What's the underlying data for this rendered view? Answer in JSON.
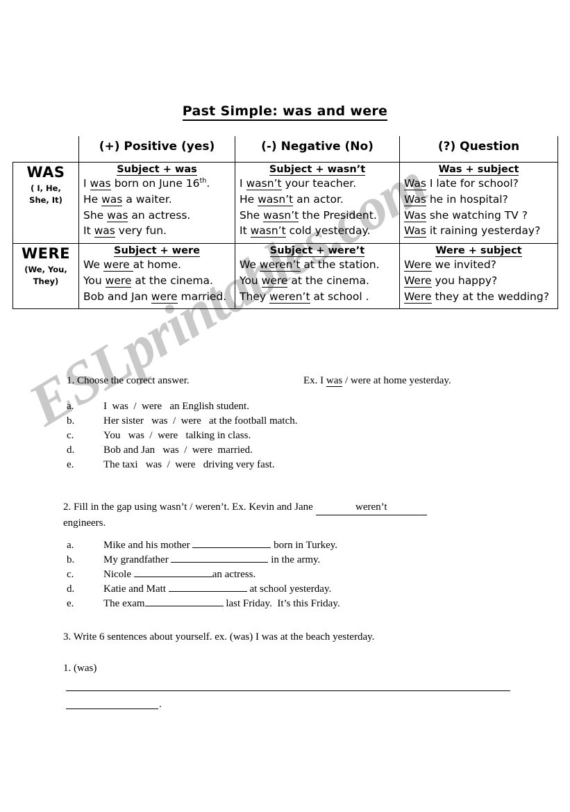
{
  "watermark": {
    "text": "ESLprintables.com"
  },
  "document": {
    "title": "Past Simple: was and were"
  },
  "table": {
    "headers": {
      "label": "",
      "positive": "(+) Positive (yes)",
      "negative": "(-) Negative (No)",
      "question": "(?) Question"
    },
    "rows": [
      {
        "label_main": "WAS",
        "label_sub": "( I, He,\nShe, It)",
        "positive": {
          "formula": "Subject  + was",
          "examples": [
            {
              "pre": "I ",
              "verb": "was",
              "post": " born on June 16",
              "sup": "th",
              "tail": "."
            },
            {
              "pre": "He ",
              "verb": "was",
              "post": " a waiter.",
              "sup": "",
              "tail": ""
            },
            {
              "pre": "She ",
              "verb": "was",
              "post": " an actress.",
              "sup": "",
              "tail": ""
            },
            {
              "pre": "It ",
              "verb": "was",
              "post": " very fun.",
              "sup": "",
              "tail": ""
            }
          ]
        },
        "negative": {
          "formula": "Subject  + wasn’t",
          "examples": [
            {
              "pre": "I ",
              "verb": "wasn’t",
              "post": " your teacher.",
              "sup": "",
              "tail": ""
            },
            {
              "pre": "He ",
              "verb": "wasn’t",
              "post": " an actor.",
              "sup": "",
              "tail": ""
            },
            {
              "pre": "She ",
              "verb": "wasn’t",
              "post": " the President.",
              "sup": "",
              "tail": ""
            },
            {
              "pre": "It ",
              "verb": "wasn’t",
              "post": " cold yesterday.",
              "sup": "",
              "tail": ""
            }
          ]
        },
        "question": {
          "formula": "Was + subject",
          "examples": [
            {
              "pre": "",
              "verb": "Was",
              "post": " I late for school?",
              "sup": "",
              "tail": ""
            },
            {
              "pre": "",
              "verb": "Was",
              "post": " he in hospital?",
              "sup": "",
              "tail": ""
            },
            {
              "pre": "",
              "verb": "Was",
              "post": " she watching TV ?",
              "sup": "",
              "tail": ""
            },
            {
              "pre": "",
              "verb": "Was",
              "post": " it raining yesterday?",
              "sup": "",
              "tail": ""
            }
          ]
        }
      },
      {
        "label_main": "WERE",
        "label_sub": "(We, You,\nThey)",
        "positive": {
          "formula": "Subject  + were",
          "examples": [
            {
              "pre": "We ",
              "verb": "were ",
              "post": "at home.",
              "sup": "",
              "tail": ""
            },
            {
              "pre": "You ",
              "verb": "were",
              "post": " at the cinema.",
              "sup": "",
              "tail": ""
            },
            {
              "pre": "Bob and Jan ",
              "verb": "were",
              "post": " married.",
              "sup": "",
              "tail": ""
            }
          ]
        },
        "negative": {
          "formula": "Subject  + were’t",
          "examples": [
            {
              "pre": "We ",
              "verb": "weren’t",
              "post": " at the station.",
              "sup": "",
              "tail": ""
            },
            {
              "pre": "You ",
              "verb": "were",
              "post": " at the cinema.",
              "sup": "",
              "tail": ""
            },
            {
              "pre": "They ",
              "verb": "weren’t",
              "post": " at school .",
              "sup": "",
              "tail": ""
            }
          ]
        },
        "question": {
          "formula": "Were + subject",
          "examples": [
            {
              "pre": "",
              "verb": "Were",
              "post": " we invited?",
              "sup": "",
              "tail": ""
            },
            {
              "pre": "",
              "verb": "Were",
              "post": " you happy?",
              "sup": "",
              "tail": ""
            },
            {
              "pre": "",
              "verb": "Were",
              "post": " they at the wedding?",
              "sup": "",
              "tail": ""
            }
          ]
        }
      }
    ]
  },
  "exercise1": {
    "instruction": "1.  Choose the correct answer.",
    "example_pre": "Ex. I  ",
    "example_underlined": "was",
    "example_post": " / were at home yesterday.",
    "items": [
      {
        "letter": "a.",
        "text": "I  was  /  were   an English student."
      },
      {
        "letter": "b.",
        "text": "Her sister   was  /  were   at the football match."
      },
      {
        "letter": "c.",
        "text": "You   was  /  were   talking in class."
      },
      {
        "letter": "d.",
        "text": "Bob and Jan   was  /  were  married."
      },
      {
        "letter": "e.",
        "text": "The taxi   was  /  were   driving very fast."
      }
    ]
  },
  "exercise2": {
    "instruction_pre": "2.  Fill in the gap using wasn’t / weren’t. Ex. Kevin and Jane",
    "example_answer": "weren’t",
    "instruction_post": "engineers.",
    "items": [
      {
        "letter": "a.",
        "pre": "Mike and his mother ",
        "gap": 113,
        "post": " born in Turkey."
      },
      {
        "letter": "b.",
        "pre": "My grandfather ",
        "gap": 140,
        "post": " in the army."
      },
      {
        "letter": "c.",
        "pre": "Nicole ",
        "gap": 113,
        "post": "an actress."
      },
      {
        "letter": "d.",
        "pre": "Katie and Matt ",
        "gap": 113,
        "post": " at school yesterday."
      },
      {
        "letter": "e.",
        "pre": "The exam",
        "gap": 113,
        "post": " last Friday.  It’s this Friday."
      }
    ]
  },
  "exercise3": {
    "instruction": "3. Write 6 sentences about yourself.  ex.  (was) I was at the beach yesterday.",
    "first_item": "1. (was)",
    "trailing_period": "."
  }
}
